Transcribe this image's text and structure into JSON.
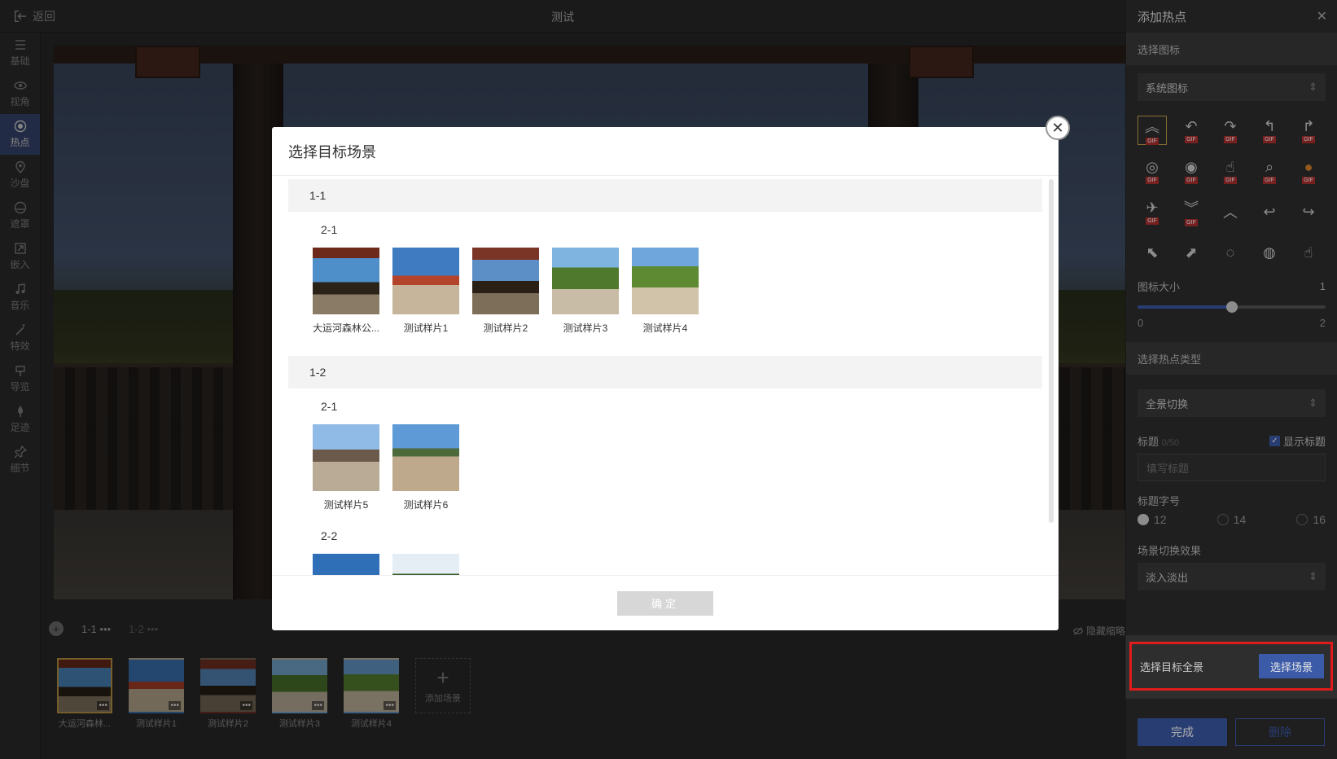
{
  "topbar": {
    "back_label": "返回",
    "title": "测试"
  },
  "leftnav": [
    {
      "label": "基础",
      "icon": "list-icon",
      "active": false
    },
    {
      "label": "视角",
      "icon": "eye-icon",
      "active": false
    },
    {
      "label": "热点",
      "icon": "target-icon",
      "active": true
    },
    {
      "label": "沙盘",
      "icon": "map-pin-icon",
      "active": false
    },
    {
      "label": "遮罩",
      "icon": "mask-icon",
      "active": false
    },
    {
      "label": "嵌入",
      "icon": "embed-icon",
      "active": false
    },
    {
      "label": "音乐",
      "icon": "music-icon",
      "active": false
    },
    {
      "label": "特效",
      "icon": "wand-icon",
      "active": false
    },
    {
      "label": "导览",
      "icon": "guide-icon",
      "active": false
    },
    {
      "label": "足迹",
      "icon": "footprint-icon",
      "active": false
    },
    {
      "label": "细节",
      "icon": "pin-icon",
      "active": false
    }
  ],
  "scenebar": {
    "tabs": [
      "1-1",
      "1-2"
    ],
    "tab_more": "•••",
    "hide_label": "隐藏缩略",
    "thumbs": [
      {
        "caption": "大运河森林...",
        "dots": "•••"
      },
      {
        "caption": "测试样片1",
        "dots": "•••"
      },
      {
        "caption": "测试样片2",
        "dots": "•••"
      },
      {
        "caption": "测试样片3",
        "dots": "•••"
      },
      {
        "caption": "测试样片4",
        "dots": "•••"
      }
    ],
    "add_label": "添加场景",
    "add_icon": "+"
  },
  "rightpanel": {
    "title": "添加热点",
    "close_icon": "✕",
    "section_icon": "选择图标",
    "icon_source": "系统图标",
    "select_arrow": "⇕",
    "gif_badge": "GIF",
    "icons": [
      {
        "name": "double-chevron-up-icon",
        "glyph": "︽",
        "gif": true
      },
      {
        "name": "turn-left-icon",
        "glyph": "↶",
        "gif": true
      },
      {
        "name": "turn-right-icon",
        "glyph": "↷",
        "gif": true
      },
      {
        "name": "up-left-arrow-icon",
        "glyph": "↰",
        "gif": true
      },
      {
        "name": "up-right-arrow-icon",
        "glyph": "↱",
        "gif": true
      },
      {
        "name": "ring-icon",
        "glyph": "◎",
        "gif": true
      },
      {
        "name": "dot-ring-icon",
        "glyph": "◉",
        "gif": true
      },
      {
        "name": "hand-pointer-icon",
        "glyph": "☝",
        "gif": true
      },
      {
        "name": "magnifier-icon",
        "glyph": "⌕",
        "gif": true
      },
      {
        "name": "orange-dot-icon",
        "glyph": "●",
        "gif": true
      },
      {
        "name": "helicopter-icon",
        "glyph": "✈",
        "gif": true
      },
      {
        "name": "double-chevron-down-icon",
        "glyph": "︾",
        "gif": true
      },
      {
        "name": "chevron-up-icon",
        "glyph": "︿",
        "gif": false
      },
      {
        "name": "back-arrow-icon",
        "glyph": "↩",
        "gif": false
      },
      {
        "name": "forward-arrow-icon",
        "glyph": "↪",
        "gif": false
      },
      {
        "name": "arrow-up-left-icon",
        "glyph": "⬉",
        "gif": false
      },
      {
        "name": "arrow-up-right-icon",
        "glyph": "⬈",
        "gif": false
      },
      {
        "name": "small-ring-icon",
        "glyph": "◌",
        "gif": false
      },
      {
        "name": "glow-dot-icon",
        "glyph": "◍",
        "gif": false
      },
      {
        "name": "small-hand-icon",
        "glyph": "☝",
        "gif": false
      }
    ],
    "icon_size_label": "图标大小",
    "icon_size_value": "1",
    "icon_size_fraction": 0.5,
    "icon_size_min": "0",
    "icon_size_max": "2",
    "section_type": "选择热点类型",
    "hotspot_type": "全景切换",
    "title_label": "标题",
    "title_count": "0/50",
    "show_title_label": "显示标题",
    "title_placeholder": "填写标题",
    "font_size_label": "标题字号",
    "font_sizes": [
      "12",
      "14",
      "16"
    ],
    "transition_label": "场景切换效果",
    "transition_value": "淡入淡出",
    "target_label": "选择目标全景",
    "target_button": "选择场景",
    "done_button": "完成",
    "delete_button": "删除"
  },
  "modal": {
    "title": "选择目标场景",
    "close_icon": "✕",
    "groups": [
      {
        "name": "1-1",
        "subgroups": [
          {
            "name": "2-1",
            "scenes": [
              "大运河森林公...",
              "测试样片1",
              "测试样片2",
              "测试样片3",
              "测试样片4"
            ]
          }
        ]
      },
      {
        "name": "1-2",
        "subgroups": [
          {
            "name": "2-1",
            "scenes": [
              "测试样片5",
              "测试样片6"
            ]
          },
          {
            "name": "2-2",
            "scenes": []
          }
        ]
      }
    ],
    "confirm_button": "确定"
  },
  "colors": {
    "accent": "#3b5aa8",
    "highlight": "#e01b1b",
    "selected": "#c9a34a"
  }
}
